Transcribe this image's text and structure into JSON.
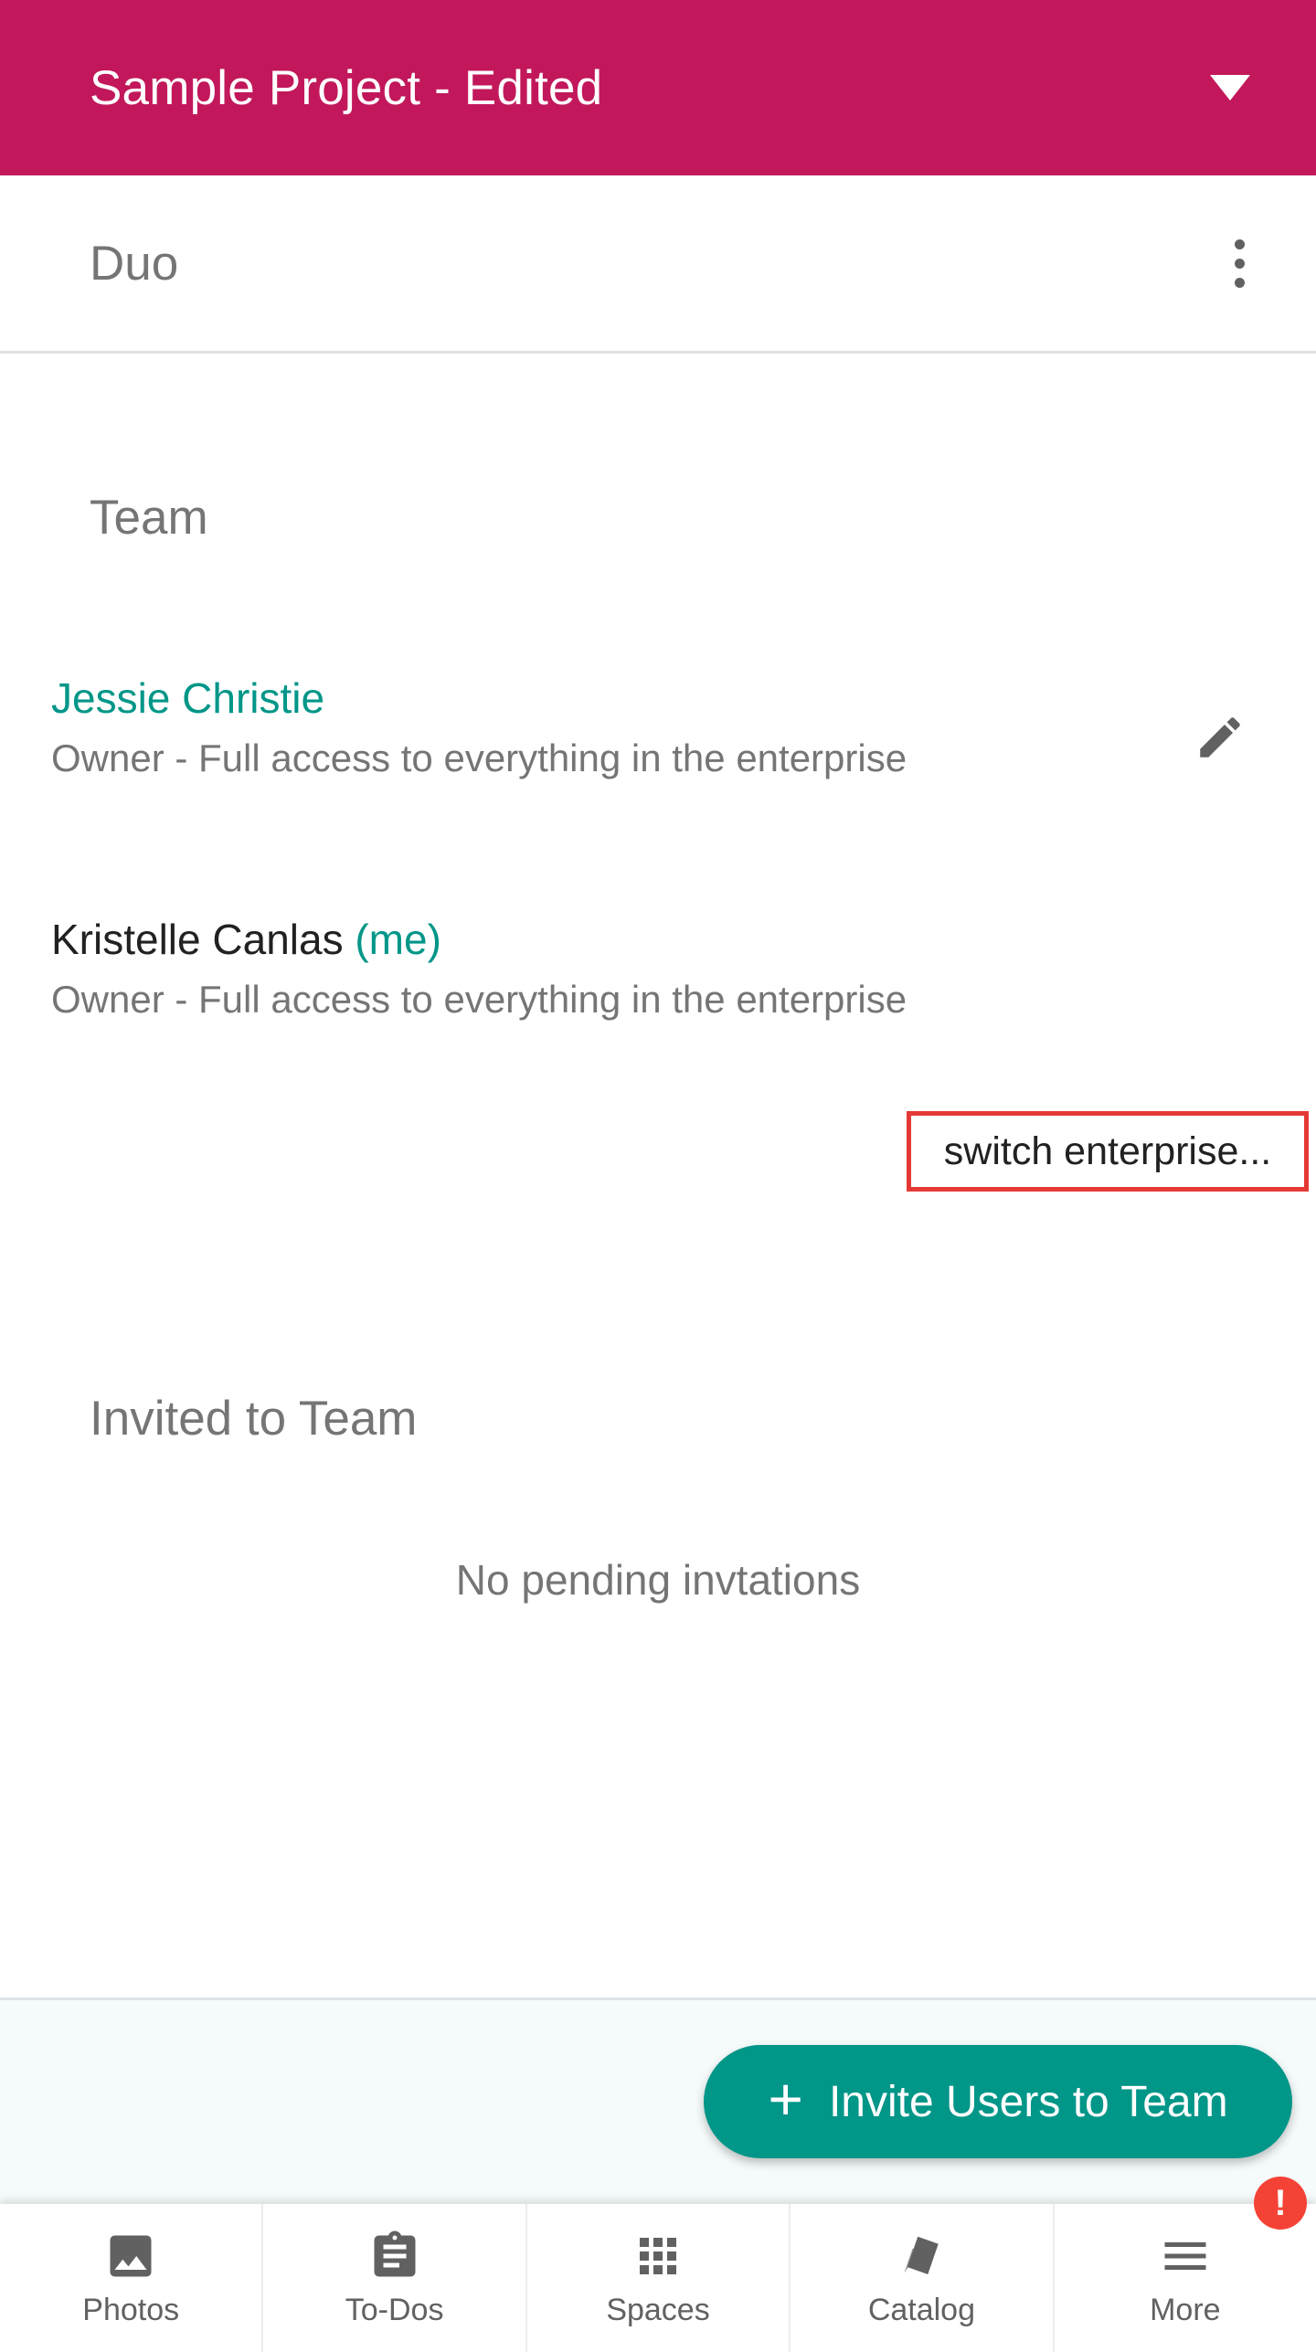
{
  "header": {
    "title": "Sample Project - Edited"
  },
  "workspace": {
    "name": "Duo"
  },
  "team": {
    "heading": "Team",
    "members": [
      {
        "name": "Jessie Christie",
        "role": "Owner - Full access to everything in the enterprise"
      },
      {
        "name": "Kristelle Canlas",
        "me_tag": "(me)",
        "role": "Owner - Full access to everything in the enterprise"
      }
    ],
    "switch_link": "switch enterprise..."
  },
  "invited": {
    "heading": "Invited to Team",
    "empty_text": "No pending invtations"
  },
  "fab": {
    "icon": "plus-icon",
    "label": "Invite Users to Team"
  },
  "nav": {
    "items": [
      {
        "label": "Photos",
        "icon": "photo-icon"
      },
      {
        "label": "To-Dos",
        "icon": "clipboard-icon"
      },
      {
        "label": "Spaces",
        "icon": "grid-icon"
      },
      {
        "label": "Catalog",
        "icon": "swatch-icon"
      },
      {
        "label": "More",
        "icon": "menu-icon"
      }
    ],
    "alert_badge": "!"
  },
  "colors": {
    "brand": "#c2185b",
    "accent": "#009688",
    "highlight_border": "#e53935",
    "badge": "#f44336"
  }
}
